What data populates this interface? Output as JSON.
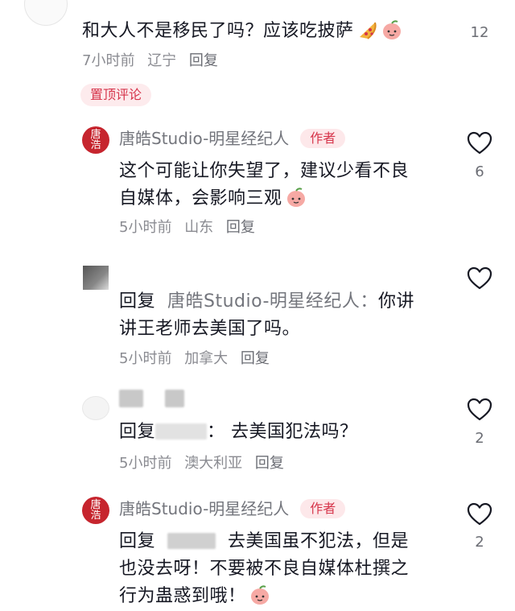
{
  "c0": {
    "text": "和大人不是移民了吗？应该吃披萨",
    "time": "7小时前",
    "location": "辽宁",
    "reply": "回复",
    "likes": "12",
    "emojis": [
      "pizza-icon",
      "peach-face-icon"
    ]
  },
  "pinned_label": "置顶评论",
  "c1": {
    "name": "唐皓Studio-明星经纪人",
    "badge": "作者",
    "line1": "这个可能让你失望了，建议少看不良",
    "line2": "自媒体，会影响三观",
    "time": "5小时前",
    "location": "山东",
    "reply": "回复",
    "likes": "6"
  },
  "c2": {
    "reply_prefix": "回复",
    "reply_to": "唐皓Studio-明星经纪人：",
    "line1_tail": "你讲",
    "line2": "讲王老师去美国了吗。",
    "time": "5小时前",
    "location": "加拿大",
    "reply": "回复"
  },
  "c3": {
    "reply_prefix": "回复",
    "text": "：  去美国犯法吗？",
    "time": "5小时前",
    "location": "澳大利亚",
    "reply": "回复",
    "likes": "2"
  },
  "c4": {
    "name": "唐皓Studio-明星经纪人",
    "badge": "作者",
    "reply_prefix": "回复",
    "line1_tail": "去美国虽不犯法，但是",
    "line2": "也没去呀！不要被不良自媒体杜撰之",
    "line3": "行为蛊惑到哦！",
    "likes": "2"
  },
  "colors": {
    "accent": "#d6344a",
    "badge_bg": "#fde8ea",
    "meta": "#8a8b91"
  }
}
